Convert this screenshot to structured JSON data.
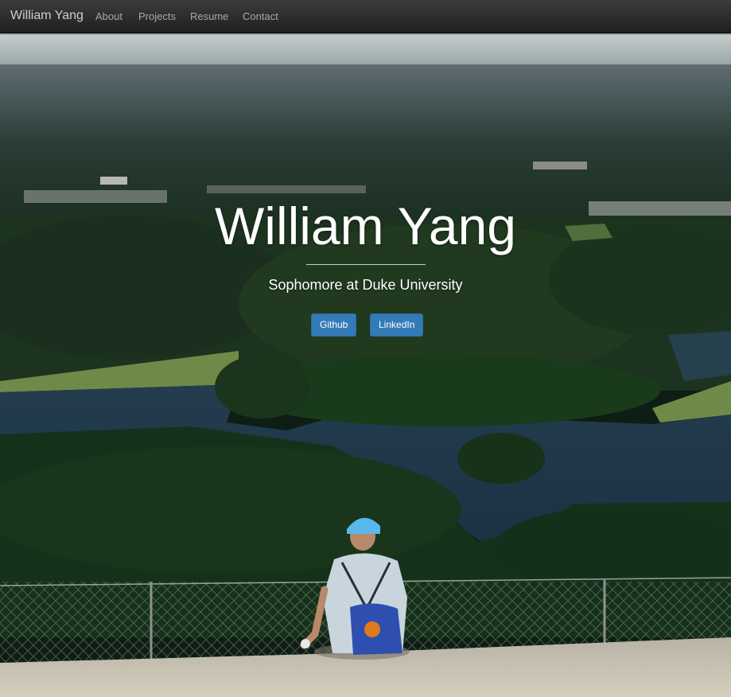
{
  "navbar": {
    "brand": "William Yang",
    "links": [
      "About",
      "Projects",
      "Resume",
      "Contact"
    ]
  },
  "hero": {
    "title": "William Yang",
    "subtitle": "Sophomore at Duke University",
    "buttons": [
      "Github",
      "LinkedIn"
    ]
  },
  "colors": {
    "navbar": "#2b2b2b",
    "button": "#337ab7",
    "text": "#ffffff"
  }
}
